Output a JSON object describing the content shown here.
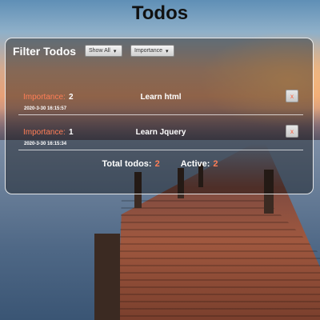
{
  "app": {
    "title": "Todos"
  },
  "filter": {
    "title": "Filter Todos",
    "status_select": "Show All",
    "sort_select": "Importance"
  },
  "todos": [
    {
      "importance_label": "Importance:",
      "importance": "2",
      "name": "Learn html",
      "date": "2020-3-30 16:15:57",
      "delete_label": "x"
    },
    {
      "importance_label": "Importance:",
      "importance": "1",
      "name": "Learn Jquery",
      "date": "2020-3-30 16:15:34",
      "delete_label": "x"
    }
  ],
  "totals": {
    "total_label": "Total todos:",
    "total": "2",
    "active_label": "Active:",
    "active": "2"
  },
  "colors": {
    "accent": "#ff7e57",
    "panel_border": "#ffffff",
    "text": "#ffffff"
  }
}
